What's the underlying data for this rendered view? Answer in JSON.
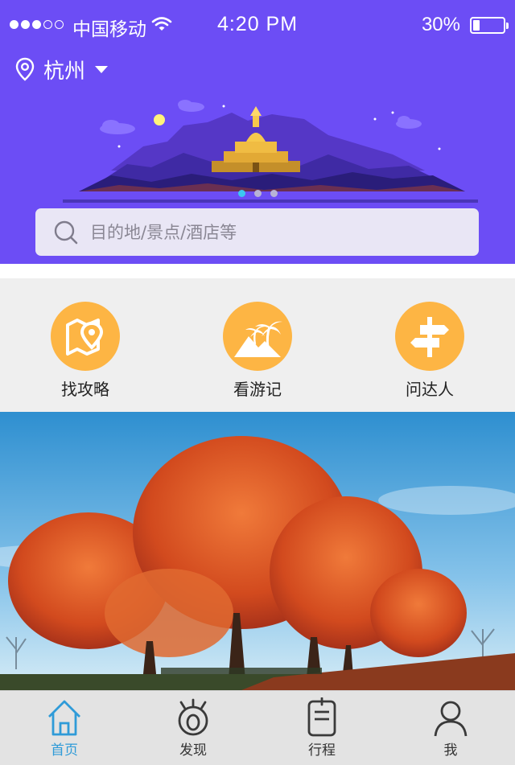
{
  "status_bar": {
    "signal_dots": [
      true,
      true,
      true,
      false,
      false
    ],
    "carrier": "中国移动",
    "time": "4:20 PM",
    "battery_percent": "30%",
    "battery_level": 0.3
  },
  "location": {
    "city": "杭州"
  },
  "banner": {
    "slide_count": 3,
    "active_slide": 0
  },
  "search": {
    "placeholder": "目的地/景点/酒店等"
  },
  "quick_entries": [
    {
      "label": "找攻略",
      "icon": "map-pin-icon"
    },
    {
      "label": "看游记",
      "icon": "palm-island-icon"
    },
    {
      "label": "问达人",
      "icon": "signpost-icon"
    }
  ],
  "tabs": [
    {
      "label": "首页",
      "icon": "home-icon",
      "active": true
    },
    {
      "label": "发现",
      "icon": "discover-eye-icon",
      "active": false
    },
    {
      "label": "行程",
      "icon": "itinerary-clipboard-icon",
      "active": false
    },
    {
      "label": "我",
      "icon": "profile-icon",
      "active": false
    }
  ],
  "colors": {
    "header_bg": "#6c4df5",
    "accent_orange": "#fdb544",
    "tab_active": "#2f9bd8"
  }
}
